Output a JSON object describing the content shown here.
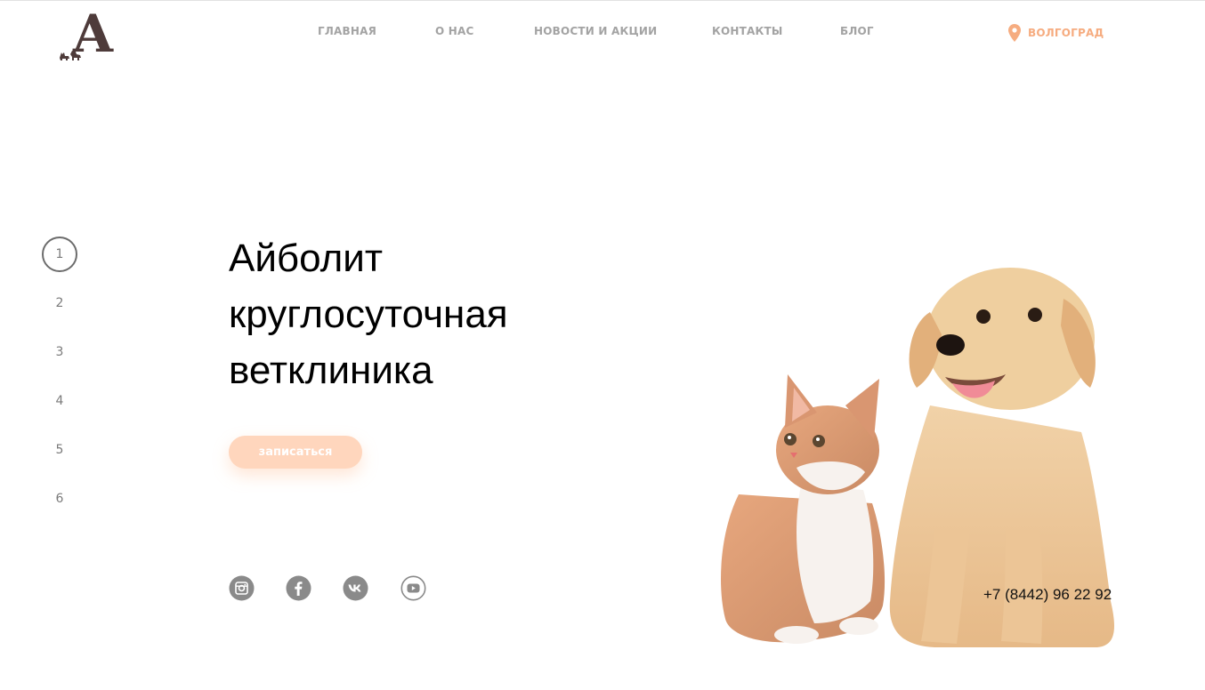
{
  "header": {
    "logo_letter": "A",
    "nav": [
      {
        "label": "ГЛАВНАЯ"
      },
      {
        "label": "О НАС"
      },
      {
        "label": "НОВОСТИ И АКЦИИ"
      },
      {
        "label": "КОНТАКТЫ"
      },
      {
        "label": "БЛОГ"
      }
    ],
    "city": {
      "label": "ВОЛГОГРАД",
      "icon": "map-pin-icon"
    }
  },
  "pager": {
    "items": [
      "1",
      "2",
      "3",
      "4",
      "5",
      "6"
    ],
    "active_index": 0
  },
  "hero": {
    "title_lines": [
      "Айболит",
      "круглосуточная",
      "ветклиника"
    ],
    "cta_label": "записаться"
  },
  "socials": [
    {
      "name": "instagram-icon"
    },
    {
      "name": "facebook-icon"
    },
    {
      "name": "vk-icon"
    },
    {
      "name": "youtube-icon"
    }
  ],
  "contact": {
    "phone": "+7 (8442) 96 22 92"
  },
  "colors": {
    "accent": "#f6ac80",
    "cta_bg": "#ffd6bd",
    "logo": "#4e3b3a",
    "nav_text": "#a3a3a3",
    "social_icons": "#8a8a8a"
  }
}
